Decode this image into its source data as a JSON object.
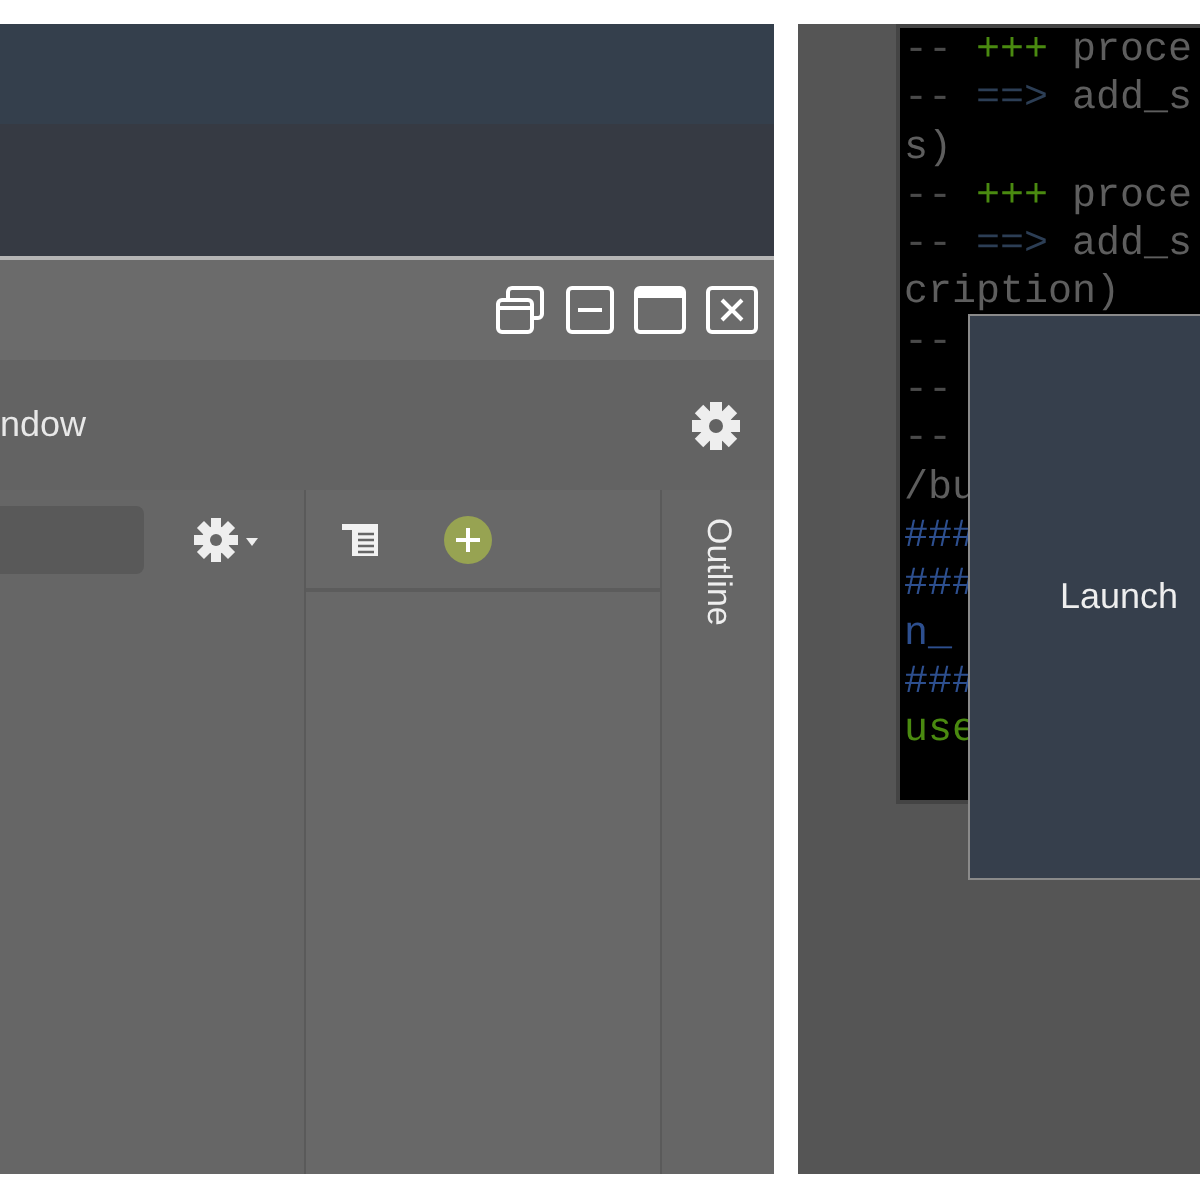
{
  "left_screen": {
    "toolbar": {
      "title": "ndow"
    },
    "side_tab": {
      "label": "Outline"
    }
  },
  "right_screen": {
    "terminal": {
      "lines": [
        {
          "segments": [
            {
              "text": "-- ",
              "kind": "dim"
            },
            {
              "text": "+++",
              "kind": "green"
            },
            {
              "text": " proce",
              "kind": "plain"
            }
          ]
        },
        {
          "segments": [
            {
              "text": "-- ",
              "kind": "dim"
            },
            {
              "text": "==>",
              "kind": "blue"
            },
            {
              "text": " add_s",
              "kind": "plain"
            }
          ]
        },
        {
          "segments": [
            {
              "text": "s)",
              "kind": "plain"
            }
          ]
        },
        {
          "segments": [
            {
              "text": "-- ",
              "kind": "dim"
            },
            {
              "text": "+++",
              "kind": "green"
            },
            {
              "text": " proce",
              "kind": "plain"
            }
          ]
        },
        {
          "segments": [
            {
              "text": "-- ",
              "kind": "dim"
            },
            {
              "text": "==>",
              "kind": "blue"
            },
            {
              "text": " add_s",
              "kind": "plain"
            }
          ]
        },
        {
          "segments": [
            {
              "text": "cription)",
              "kind": "plain"
            }
          ]
        },
        {
          "segments": [
            {
              "text": "--",
              "kind": "dim"
            }
          ]
        },
        {
          "segments": [
            {
              "text": "--",
              "kind": "dim"
            }
          ]
        },
        {
          "segments": [
            {
              "text": "--",
              "kind": "dim"
            }
          ]
        },
        {
          "segments": [
            {
              "text": "/bu",
              "kind": "plain"
            }
          ]
        },
        {
          "segments": [
            {
              "text": "###",
              "kind": "navy"
            }
          ]
        },
        {
          "segments": [
            {
              "text": "###",
              "kind": "navy"
            }
          ]
        },
        {
          "segments": [
            {
              "text": "n_",
              "kind": "navy"
            }
          ]
        },
        {
          "segments": [
            {
              "text": "###",
              "kind": "navy"
            }
          ]
        },
        {
          "segments": [
            {
              "text": "use",
              "kind": "green"
            }
          ]
        }
      ]
    },
    "dialog": {
      "label": "Launch"
    }
  }
}
